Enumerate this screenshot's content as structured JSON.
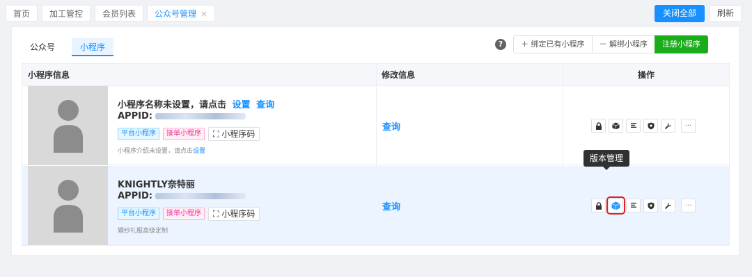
{
  "tabs": [
    {
      "label": "首页",
      "active": false
    },
    {
      "label": "加工管控",
      "active": false
    },
    {
      "label": "会员列表",
      "active": false
    },
    {
      "label": "公众号管理",
      "active": true
    }
  ],
  "tab_close_glyph": "×",
  "actions": {
    "close_all": "关闭全部",
    "refresh": "刷新"
  },
  "subtabs": {
    "official": "公众号",
    "mini": "小程序"
  },
  "toolbar": {
    "help": "?",
    "bind": "＋ 绑定已有小程序",
    "unbind": "－ 解绑小程序",
    "register": "注册小程序"
  },
  "table": {
    "headers": {
      "info": "小程序信息",
      "modify": "修改信息",
      "ops": "操作"
    },
    "rows": [
      {
        "name_prefix": "小程序名称未设置，请点击",
        "name_link_set": "设置",
        "name_link_query": "查询",
        "appid_label": "APPID:",
        "tag_platform": "平台小程序",
        "tag_order": "接单小程序",
        "qr_label": "⛶ 小程序码",
        "desc_text": "小程序介绍未设置，请点击",
        "desc_link": "设置",
        "modify_link": "查询"
      },
      {
        "name_prefix": "KNIGHTLY奈特丽",
        "appid_label": "APPID:",
        "tag_platform": "平台小程序",
        "tag_order": "接单小程序",
        "qr_label": "⛶ 小程序码",
        "desc_text": "婚纱礼服高级定制",
        "modify_link": "查询"
      }
    ]
  },
  "op_icons": [
    "lock-icon",
    "cube-icon",
    "list-icon",
    "shield-icon",
    "wrench-icon",
    "more-icon"
  ],
  "more_glyph": "···",
  "tooltip": "版本管理",
  "colors": {
    "primary": "#1890ff",
    "green": "#1aad19",
    "highlight_row": "#ecf5ff",
    "selection": "#e02020"
  }
}
